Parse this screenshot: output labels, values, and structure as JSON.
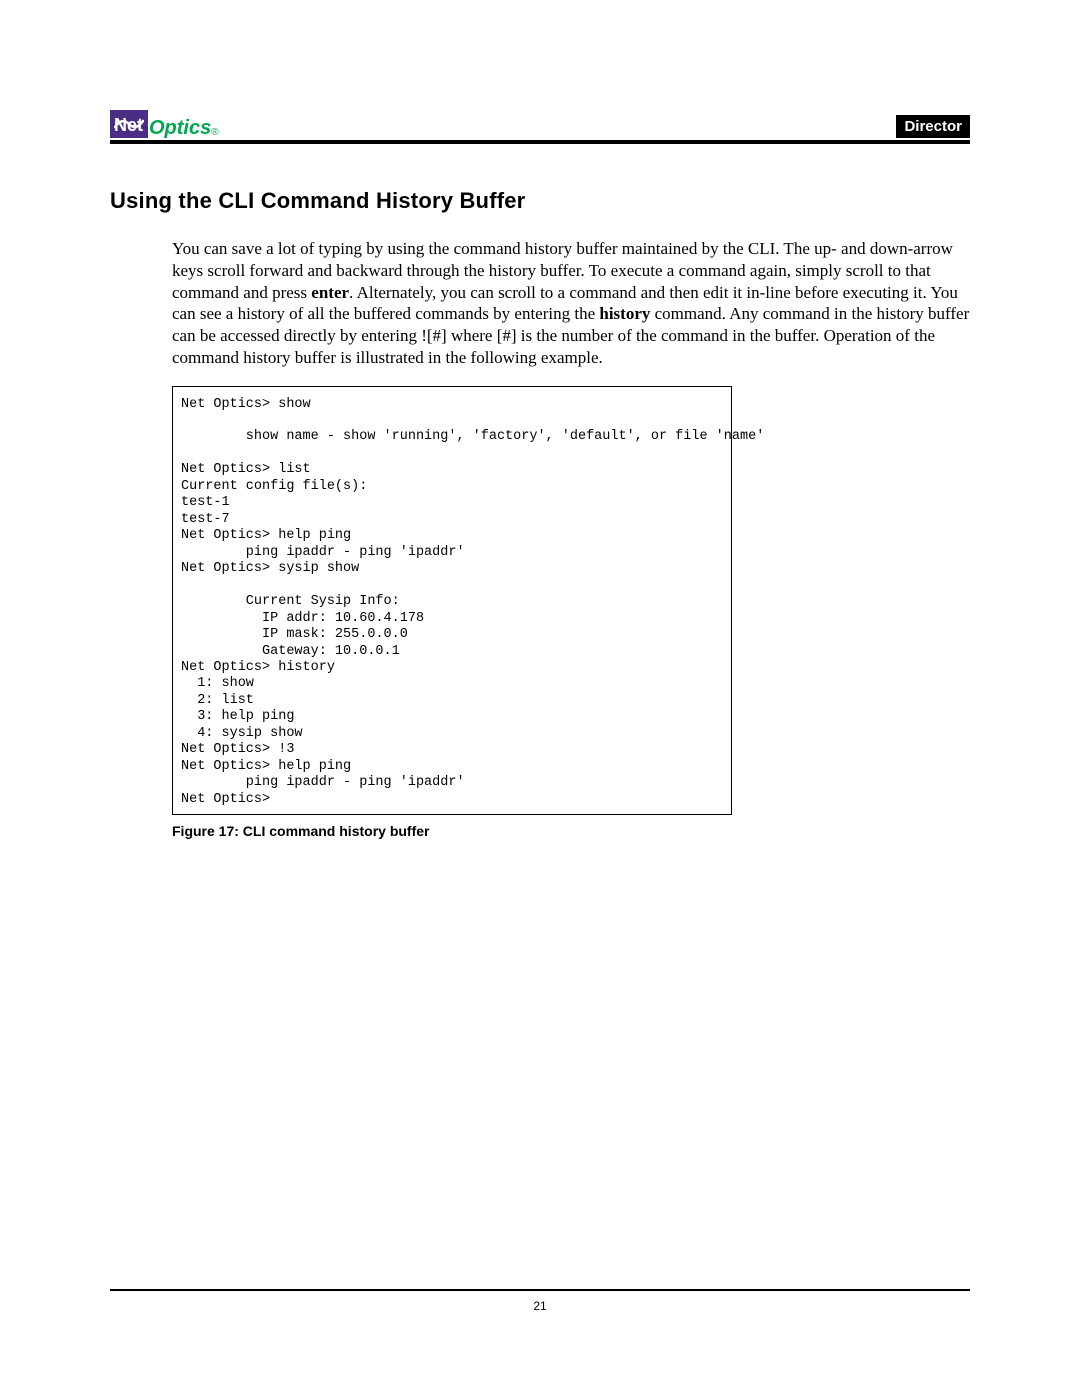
{
  "header": {
    "logo_net": "Net",
    "logo_optics": "Optics",
    "logo_reg": "®",
    "badge": "Director"
  },
  "section": {
    "title": "Using the CLI Command History Buffer",
    "para_pre": "You can save a lot of typing by using the command history buffer maintained by the CLI. The up- and down-arrow keys scroll forward and backward through the history buffer. To execute a command again, simply scroll to that command and press ",
    "para_bold1": "enter",
    "para_mid": ". Alternately, you can scroll to a command and then edit it in-line before executing it. You can see a history of all the buffered commands by entering the ",
    "para_bold2": "history",
    "para_post": " command. Any command in the history buffer can be accessed directly by entering ![#] where [#] is the number of the command in the buffer. Operation of the command history buffer is illustrated in the following example."
  },
  "cli": "Net Optics> show\n\n        show name - show 'running', 'factory', 'default', or file 'name'\n\nNet Optics> list\nCurrent config file(s):\ntest-1\ntest-7\nNet Optics> help ping\n        ping ipaddr - ping 'ipaddr'\nNet Optics> sysip show\n\n        Current Sysip Info:\n          IP addr: 10.60.4.178\n          IP mask: 255.0.0.0\n          Gateway: 10.0.0.1\nNet Optics> history\n  1: show\n  2: list\n  3: help ping\n  4: sysip show\nNet Optics> !3\nNet Optics> help ping\n        ping ipaddr - ping 'ipaddr'\nNet Optics>",
  "figure_caption": "Figure 17: CLI command history buffer",
  "footer": {
    "page_number": "21"
  }
}
